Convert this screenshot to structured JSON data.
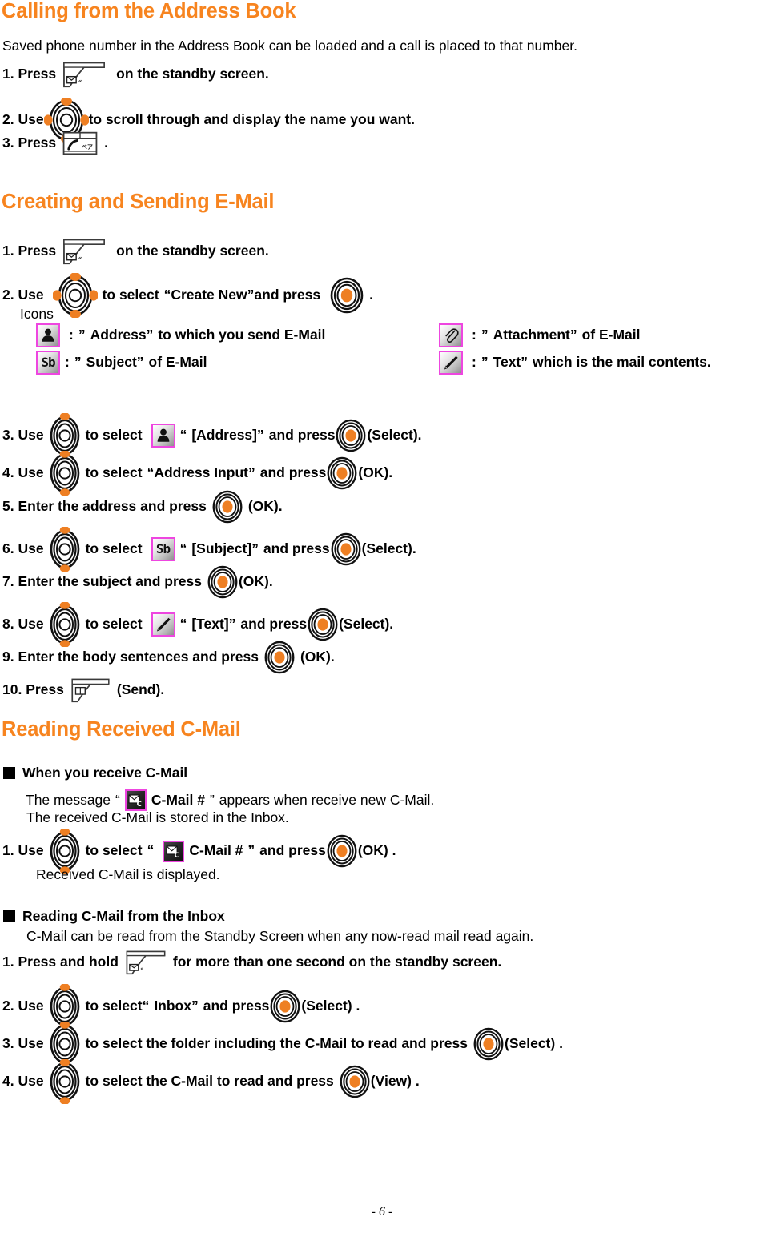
{
  "page": {
    "footer": "- 6 -",
    "accent_color": "#F7841F",
    "icon_border_color": "#EE46E0",
    "text_color": "#000000",
    "background_color": "#FFFFFF"
  },
  "sections": [
    {
      "title": "Calling from the Address Book",
      "intro": "Saved phone number in the Address Book can be loaded and a call is placed to that number.",
      "steps": [
        {
          "num": "1. Press",
          "tail": "on the standby screen.",
          "icon": "email-softkey"
        },
        {
          "num": "2. Use",
          "tail": "to scroll through and display the name you want.",
          "icon": "nav-key"
        },
        {
          "num": "3. Press",
          "tail": ".",
          "icon": "call-key"
        }
      ]
    },
    {
      "title": "Creating and Sending E-Mail",
      "step1": {
        "lead": "1. Press",
        "tail": "on the standby screen."
      },
      "step2": {
        "lead": "2. Use",
        "mid": "to select",
        "quoted": "Create New",
        "mid2": "and press",
        "tail": "."
      },
      "icons_label": "Icons",
      "icons_legend": [
        {
          "glyph": "address-person-icon",
          "sep": ":",
          "quoted": "Address",
          "text": "to which you send E-Mail"
        },
        {
          "glyph": "subject-sb-icon",
          "sep": ":",
          "quoted": "Subject",
          "text": "of E-Mail"
        },
        {
          "glyph": "attachment-paperclip-icon",
          "sep": ":",
          "quoted": "Attachment",
          "text": "of E-Mail"
        },
        {
          "glyph": "text-pencil-icon",
          "sep": ":",
          "quoted": "Text",
          "text": "which is the mail contents."
        }
      ],
      "steps": [
        {
          "num": "3. Use",
          "mid": "to select",
          "glyph": "address-person-icon",
          "bracket": "[Address]",
          "mid2": "and press",
          "tail": "(Select)."
        },
        {
          "num": "4. Use",
          "mid": "to select",
          "quoted": "Address Input",
          "mid2": "and press",
          "tail": "(OK)."
        },
        {
          "num": "5. Enter the address and press",
          "tail": "(OK)."
        },
        {
          "num": "6. Use",
          "mid": "to select",
          "glyph": "subject-sb-icon",
          "bracket": "[Subject]",
          "mid2": "and press",
          "tail": "(Select)."
        },
        {
          "num": "7. Enter the subject and press",
          "tail": "(OK)."
        },
        {
          "num": "8. Use",
          "mid": "to select",
          "glyph": "text-pencil-icon",
          "bracket": "[Text]",
          "mid2": "and press",
          "tail": "(Select)."
        },
        {
          "num": "9. Enter the body sentences and press",
          "tail": "(OK)."
        },
        {
          "num": "10. Press",
          "tail": "(Send)."
        }
      ]
    },
    {
      "title": "Reading Received C-Mail",
      "block1": {
        "heading": "When you receive C-Mail",
        "line1_pre": "The message",
        "line1_icon_label": "C-Mail #",
        "line1_post": "appears when receive new C-Mail.",
        "line2": "The received C-Mail is stored in the Inbox.",
        "step1_lead": "1. Use",
        "step1_mid": "to select",
        "step1_icon_label": "C-Mail #",
        "step1_mid2": "and press",
        "step1_tail": "(OK) .",
        "note": "Received C-Mail is displayed."
      },
      "block2": {
        "heading": "Reading C-Mail from the Inbox",
        "intro": "C-Mail can be read from the Standby Screen when any now-read mail read again.",
        "steps": [
          {
            "num": "1. Press and hold",
            "tail": "for more than one second on the standby screen."
          },
          {
            "num": "2. Use",
            "mid": "to select",
            "quoted": "Inbox",
            "mid2": "and press",
            "tail": "(Select) ."
          },
          {
            "num": "3. Use",
            "mid": "to select the folder including the C-Mail to read and press",
            "tail": "(Select) ."
          },
          {
            "num": "4. Use",
            "mid": "to select the C-Mail to read and press",
            "tail": "(View) ."
          }
        ]
      }
    }
  ]
}
